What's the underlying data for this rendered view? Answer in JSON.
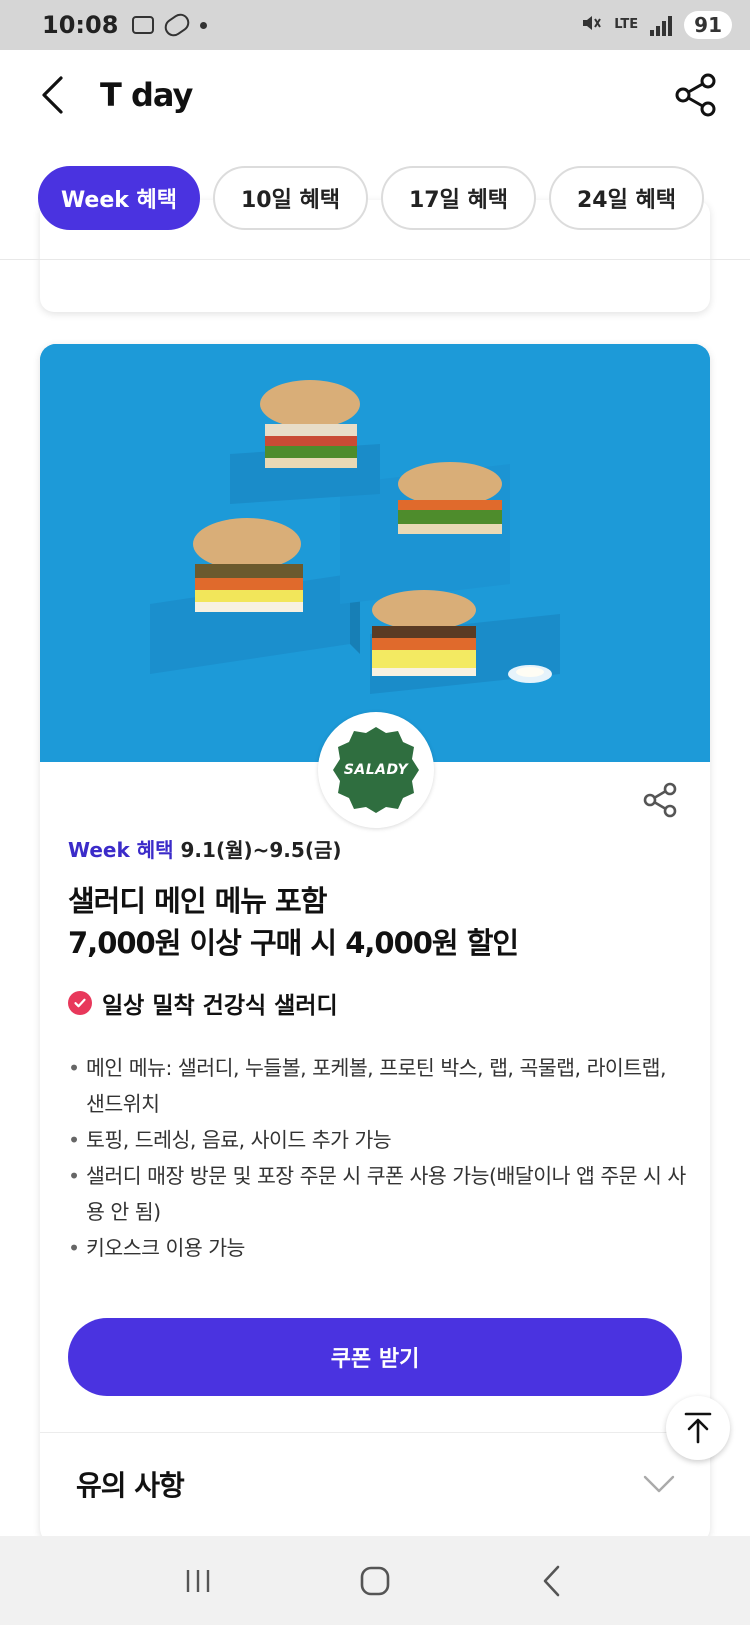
{
  "status_bar": {
    "time": "10:08",
    "network": "LTE",
    "battery": "91"
  },
  "header": {
    "title": "T day"
  },
  "tabs": [
    {
      "label": "Week 혜택",
      "active": true
    },
    {
      "label": "10일 혜택",
      "active": false
    },
    {
      "label": "17일 혜택",
      "active": false
    },
    {
      "label": "24일 혜택",
      "active": false
    }
  ],
  "card": {
    "logo_text": "SALADY",
    "period_highlight": "Week 혜택",
    "period_dates": "9.1(월)~9.5(금)",
    "title_line1": "샐러디 메인 메뉴 포함",
    "title_line2": "7,000원 이상 구매 시 4,000원 할인",
    "tagline": "일상 밀착 건강식 샐러디",
    "bullets": [
      "메인 메뉴: 샐러디, 누들볼, 포케볼, 프로틴 박스, 랩, 곡물랩, 라이트랩, 샌드위치",
      "토핑, 드레싱, 음료, 사이드 추가 가능",
      "샐러디 매장 방문 및 포장 주문 시 쿠폰 사용 가능(배달이나 앱 주문 시 사용 안 됨)",
      "키오스크 이용 가능"
    ],
    "coupon_button": "쿠폰 받기",
    "notes_heading": "유의 사항"
  },
  "colors": {
    "accent": "#4a33e0",
    "hero_bg": "#1d9ad8",
    "logo_green": "#2f6e3f",
    "check_red": "#e8385b"
  }
}
